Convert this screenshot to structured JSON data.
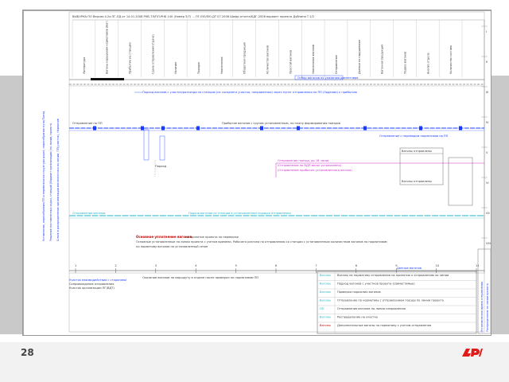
{
  "slide": {
    "page_number": "28",
    "logo_icon": "rzd-logo-icon",
    "accent_color": "#e21a1a"
  },
  "sheet": {
    "header_line": "ВЫБОРКА ПО Версия 4.2а ПГ-ЛД от 14.01.2008 РНБ-ТЛ/ПЛ-РНБ 140 (Номер 5/7) ... ПГ-ЕЮ/ЕЮ-ДТ 07.2008 Шифр отчета/БДГ-2008 вариант проекта Дубнина Т 2/2",
    "left_side_text": [
      "Уставление, пересобрание/ПП и перевозочная структура дорог, пересобрание пути/Поезд",
      "Решение поставленных задач, станций (Вариант организации) по линии, проекта",
      "Бланк в распределение организации вагонопотока по линии, ПП(участок), Норматив"
    ],
    "column_headers": [
      "Литература",
      "Вагоны нарушения нормативов (Ваг)",
      "Прибытие на станцию",
      "Сдача отправления (Сдача)",
      "Наличие",
      "Порядок",
      "Накопление",
      "Оборотная продукция",
      "Количество вагонов",
      "Простой вагонов",
      "Накопление вагонов",
      "Отправление",
      "Данные по нарушениям",
      "Вагонная продукция",
      "Подвоз вагонов",
      "Анализ отдела",
      "Количество состава"
    ],
    "right_axis_labels": [
      "I",
      "II",
      "III",
      "IV",
      "V",
      "VI",
      "VII",
      "VIII"
    ],
    "annotations": {
      "top_blue": "Отбор вагонов по указанию диспетчера",
      "blue_note": "Подход вагонов с участка/разъезда на станцию (из соседнего участка, направления) через пункт отправления по ПП (Задание) к прибытию",
      "train_mark": "Отправление по ПП",
      "mid_note": "Прибытие вагонов с грузом установленным, по плану формирования поездов",
      "right_mid_note": "Отправление с переводом нормативов на ПП",
      "magenta_1": "Отправление поезда, до 18 часов",
      "magenta_2": "(Отправление по БДП вагон установлено)",
      "magenta_3": "(Отправление прибытия установленного вагона)",
      "small_box": "Подход",
      "right_box_top": "Вагоны отправлены",
      "right_box_bottom": "Вагоны отправлены",
      "cyan_left": "Отправление вагонов",
      "cyan_mid": "Подача вагонов со станции в установленном порядке отправления",
      "red_title": "Основное уплотнение вагонов",
      "red_text": "на принятие проекта по перевозке",
      "red_desc": "Основные установленные по линии проекта с учетом времени. Рабочего разгона по отправлению со станции с установленным количеством вагонов по нормативам",
      "red_desc2": "по нормативу вагонов на установленный сезон",
      "axis_caption": "Данные вагонов",
      "bottom_left_1": "Участок взаимодействия с сторонами",
      "bottom_left_2": "Сопровождение отправления",
      "bottom_left_3": "Участок организации ПГ(ВДТ)",
      "bottom_note": "Оказание вагонов по маршруту в отделе после проверки по нормативам ПП"
    },
    "axis_ticks": [
      "1",
      "2",
      "3",
      "4",
      "5",
      "6",
      "7",
      "8",
      "9",
      "10",
      "11"
    ],
    "legend_rows": [
      {
        "label": "Вагоны",
        "text": "Вагоны по нормативу отправления на принятие к отправлению по линии",
        "color": "#1fb5c9"
      },
      {
        "label": "Вагоны",
        "text": "Подход вагонов с участков проекта (совместимые)",
        "color": "#1fb5c9"
      },
      {
        "label": "Вагоны",
        "text": "Проверка порожних вагонов",
        "color": "#1fb5c9"
      },
      {
        "label": "Вагоны",
        "text": "Отправление по нормативу с отправлением поезда по линии проекта",
        "color": "#1fb5c9"
      },
      {
        "label": "ПП",
        "text": "Отправление вагонов по линии направления",
        "color": "#1fb5c9"
      },
      {
        "label": "Вагоны",
        "text": "Распределение на участке",
        "color": "#1fb5c9"
      },
      {
        "label": "Вагоны",
        "text": "Дополнительные вагоны по нормативу с учетом отправления",
        "color": "#d00000"
      }
    ],
    "legend_vertical_labels": [
      "Установленное время отправления",
      "Распределение по линии проекта"
    ]
  }
}
